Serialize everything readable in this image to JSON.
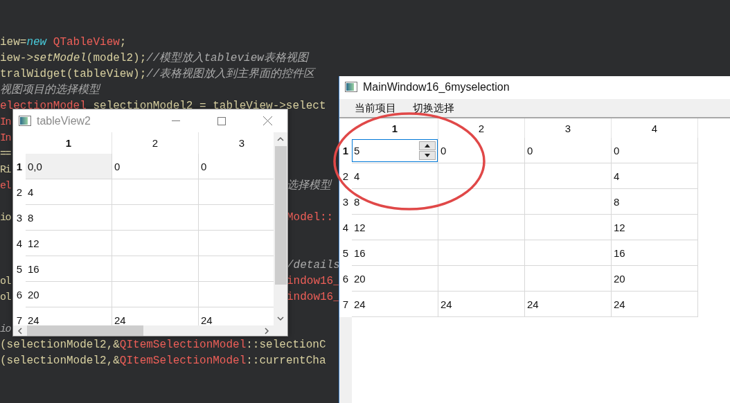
{
  "editor": {
    "lines": [
      {
        "kind": "code",
        "segments": [
          {
            "kind": "plain",
            "text": "iew="
          },
          {
            "kind": "keyword",
            "text": "new"
          },
          {
            "kind": "type",
            "text": "QTableView",
            "space_before": true
          },
          {
            "kind": "plain",
            "text": ";"
          }
        ]
      },
      {
        "kind": "code",
        "segments": [
          {
            "kind": "plain",
            "text": "iew->"
          },
          {
            "kind": "call",
            "text": "setModel"
          },
          {
            "kind": "plain",
            "text": "(model2);"
          },
          {
            "kind": "comment",
            "text": "//模型放入tableview表格视图"
          }
        ]
      },
      {
        "kind": "code",
        "segments": [
          {
            "kind": "plain",
            "text": "tralWidget(tableView);"
          },
          {
            "kind": "comment",
            "text": "//表格视图放入到主界面的控件区"
          }
        ]
      },
      {
        "kind": "code",
        "segments": [
          {
            "kind": "comment",
            "text": "视图项目的选择模型"
          }
        ]
      },
      {
        "kind": "code",
        "segments": [
          {
            "kind": "type",
            "text": "electionModel"
          },
          {
            "kind": "plain",
            "text": "selectionModel2 = tableView->select",
            "space_before": true
          }
        ]
      },
      {
        "kind": "split",
        "left": [
          {
            "kind": "type",
            "text": "In"
          }
        ]
      },
      {
        "kind": "split",
        "left": [
          {
            "kind": "type",
            "text": "In"
          }
        ]
      },
      {
        "kind": "split",
        "left": [
          {
            "kind": "plain",
            "text": "=="
          }
        ]
      },
      {
        "kind": "split",
        "left": [
          {
            "kind": "plain",
            "text": "Ri"
          }
        ]
      },
      {
        "kind": "split",
        "left": [
          {
            "kind": "type",
            "text": "el"
          }
        ],
        "right": [
          {
            "kind": "comment",
            "text": "选择模型"
          }
        ]
      },
      {
        "kind": "blank"
      },
      {
        "kind": "split",
        "left": [
          {
            "kind": "plain",
            "text": "io"
          }
        ],
        "right": [
          {
            "kind": "type",
            "text": "Model::"
          }
        ]
      },
      {
        "kind": "blank"
      },
      {
        "kind": "blank"
      },
      {
        "kind": "split",
        "right": [
          {
            "kind": "comment",
            "text": "/details"
          }
        ]
      },
      {
        "kind": "split",
        "left": [
          {
            "kind": "plain",
            "text": "ol"
          }
        ],
        "right": [
          {
            "kind": "type",
            "text": "indow16_"
          }
        ]
      },
      {
        "kind": "split",
        "left": [
          {
            "kind": "plain",
            "text": "ol"
          }
        ],
        "right": [
          {
            "kind": "type",
            "text": "indow16_"
          }
        ]
      },
      {
        "kind": "blank"
      },
      {
        "kind": "split",
        "left": [
          {
            "kind": "comment",
            "text": "io"
          }
        ]
      },
      {
        "kind": "code",
        "segments": [
          {
            "kind": "plain",
            "text": "(selectionModel2,&"
          },
          {
            "kind": "type",
            "text": "QItemSelectionModel"
          },
          {
            "kind": "plain",
            "text": "::selectionC"
          }
        ]
      },
      {
        "kind": "code",
        "segments": [
          {
            "kind": "plain",
            "text": "(selectionModel2,&"
          },
          {
            "kind": "type",
            "text": "QItemSelectionModel"
          },
          {
            "kind": "plain",
            "text": "::currentCha"
          }
        ]
      }
    ]
  },
  "table_window": {
    "title": "tableView2",
    "columns": [
      {
        "label": "1",
        "selected": true
      },
      {
        "label": "2",
        "selected": false
      },
      {
        "label": "3",
        "selected": false
      }
    ],
    "rows": [
      {
        "label": "1",
        "selected": true,
        "cells": [
          {
            "text": "0,0",
            "selected": true
          },
          {
            "text": "0",
            "selected": false
          },
          {
            "text": "0",
            "selected": false
          }
        ]
      },
      {
        "label": "2",
        "selected": false,
        "cells": [
          {
            "text": "4",
            "selected": false
          },
          {
            "selected": false
          },
          {
            "selected": false
          }
        ]
      },
      {
        "label": "3",
        "selected": false,
        "cells": [
          {
            "text": "8",
            "selected": false
          },
          {
            "selected": false
          },
          {
            "selected": false
          }
        ]
      },
      {
        "label": "4",
        "selected": false,
        "cells": [
          {
            "text": "12",
            "selected": false
          },
          {
            "selected": false
          },
          {
            "selected": false
          }
        ]
      },
      {
        "label": "5",
        "selected": false,
        "cells": [
          {
            "text": "16",
            "selected": false
          },
          {
            "selected": false
          },
          {
            "selected": false
          }
        ]
      },
      {
        "label": "6",
        "selected": false,
        "cells": [
          {
            "text": "20",
            "selected": false
          },
          {
            "selected": false
          },
          {
            "selected": false
          }
        ]
      },
      {
        "label": "7",
        "selected": false,
        "cells": [
          {
            "text": "24",
            "selected": false
          },
          {
            "text": "24",
            "selected": false
          },
          {
            "text": "24",
            "selected": false
          }
        ]
      }
    ]
  },
  "main_window": {
    "title": "MainWindow16_6myselection",
    "toolbar": [
      "当前项目",
      "切换选择"
    ],
    "columns": [
      {
        "label": "1",
        "selected": true
      },
      {
        "label": "2",
        "selected": false
      },
      {
        "label": "3",
        "selected": false
      },
      {
        "label": "4",
        "selected": false
      }
    ],
    "rows": [
      {
        "label": "1",
        "selected": true,
        "cells": [
          {
            "kind": "spinbox",
            "text": "5"
          },
          {
            "kind": "text",
            "text": "0"
          },
          {
            "kind": "text",
            "text": "0"
          },
          {
            "kind": "text",
            "text": "0"
          }
        ]
      },
      {
        "label": "2",
        "selected": false,
        "cells": [
          {
            "kind": "text",
            "text": "4"
          },
          {
            "kind": "empty"
          },
          {
            "kind": "empty"
          },
          {
            "kind": "text",
            "text": "4"
          }
        ]
      },
      {
        "label": "3",
        "selected": false,
        "cells": [
          {
            "kind": "text",
            "text": "8"
          },
          {
            "kind": "empty"
          },
          {
            "kind": "empty"
          },
          {
            "kind": "text",
            "text": "8"
          }
        ]
      },
      {
        "label": "4",
        "selected": false,
        "cells": [
          {
            "kind": "text",
            "text": "12"
          },
          {
            "kind": "empty"
          },
          {
            "kind": "empty"
          },
          {
            "kind": "text",
            "text": "12"
          }
        ]
      },
      {
        "label": "5",
        "selected": false,
        "cells": [
          {
            "kind": "text",
            "text": "16"
          },
          {
            "kind": "empty"
          },
          {
            "kind": "empty"
          },
          {
            "kind": "text",
            "text": "16"
          }
        ]
      },
      {
        "label": "6",
        "selected": false,
        "cells": [
          {
            "kind": "text",
            "text": "20"
          },
          {
            "kind": "empty"
          },
          {
            "kind": "empty"
          },
          {
            "kind": "text",
            "text": "20"
          }
        ]
      },
      {
        "label": "7",
        "selected": false,
        "cells": [
          {
            "kind": "text",
            "text": "24"
          },
          {
            "kind": "text",
            "text": "24"
          },
          {
            "kind": "text",
            "text": "24"
          },
          {
            "kind": "text",
            "text": "24"
          }
        ]
      }
    ]
  }
}
